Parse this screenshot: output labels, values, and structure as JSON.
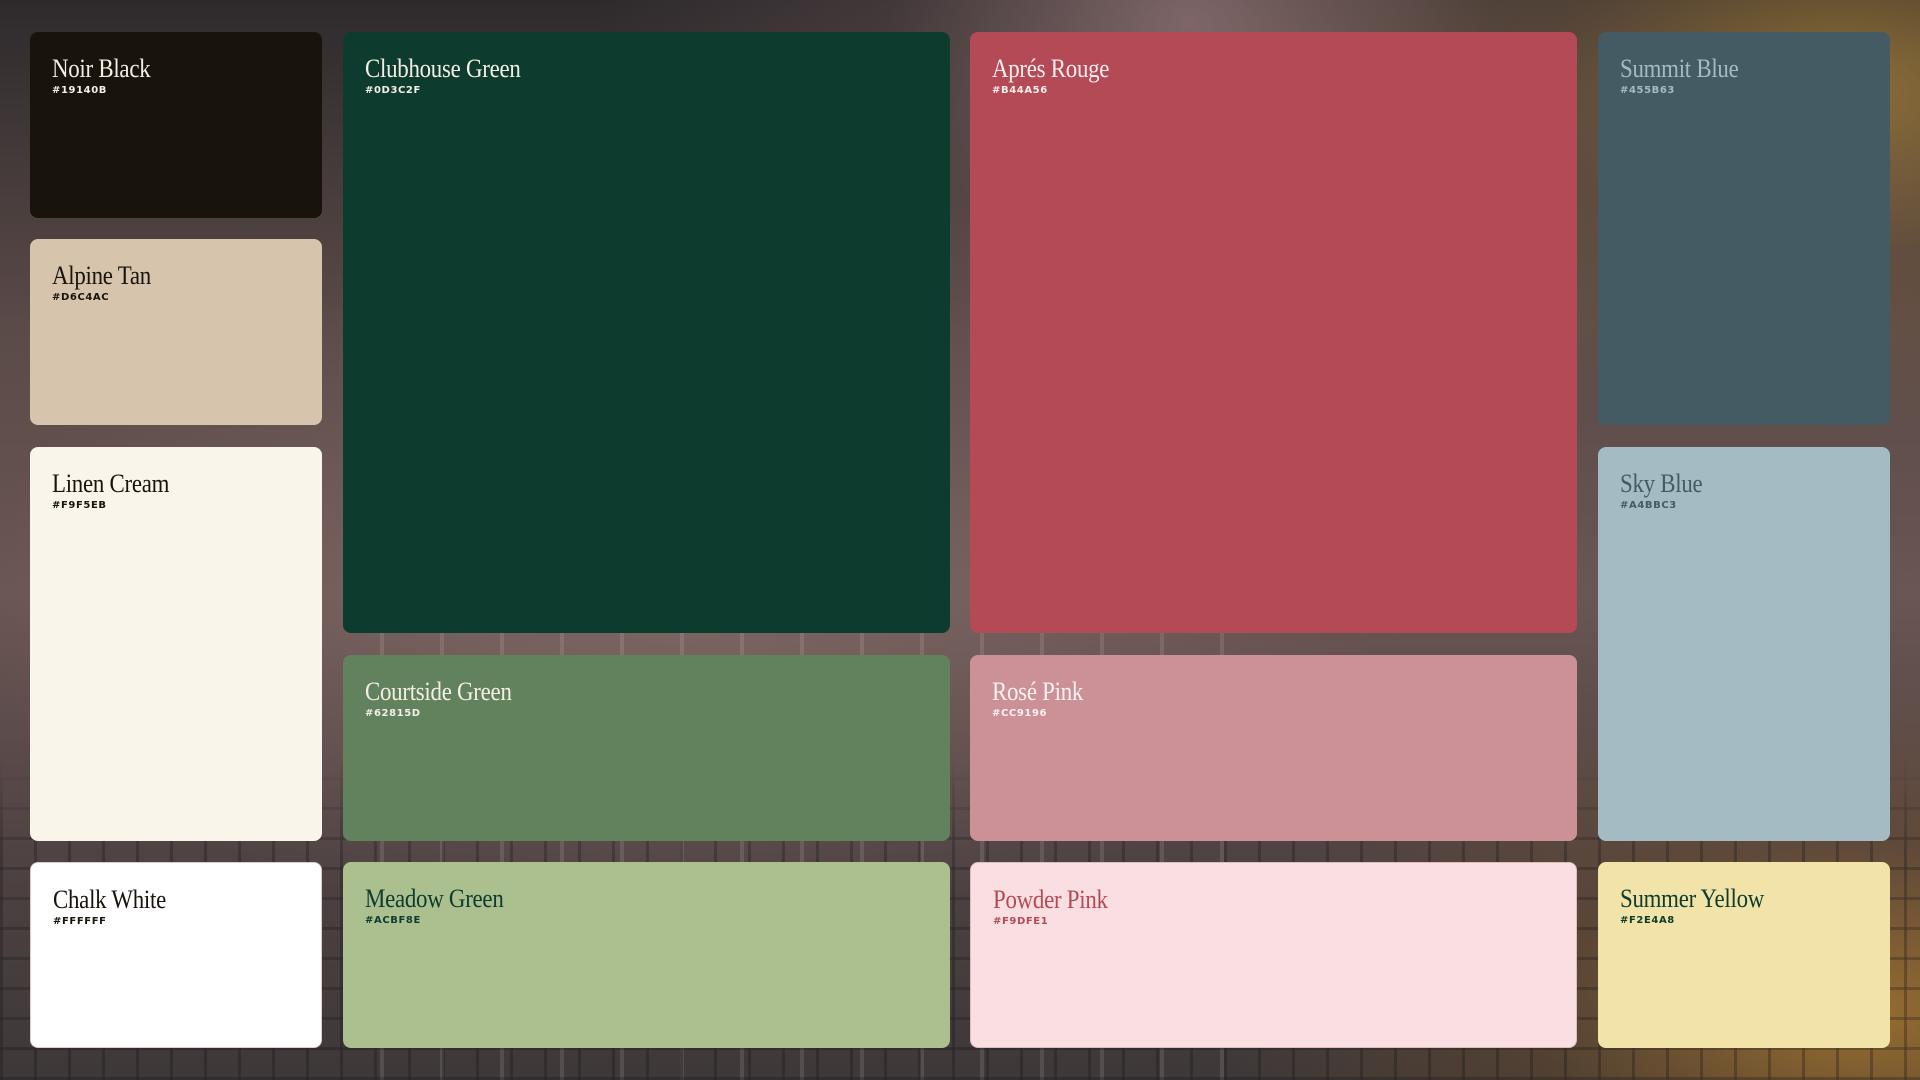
{
  "swatches": [
    {
      "id": "noir-black",
      "name": "Noir Black",
      "hex": "#19140B",
      "text_color": "#F4EFE6"
    },
    {
      "id": "alpine-tan",
      "name": "Alpine Tan",
      "hex": "#D6C4AC",
      "text_color": "#19140B"
    },
    {
      "id": "linen-cream",
      "name": "Linen Cream",
      "hex": "#F9F5EB",
      "text_color": "#19140B"
    },
    {
      "id": "chalk-white",
      "name": "Chalk White",
      "hex": "#FFFFFF",
      "text_color": "#19140B"
    },
    {
      "id": "clubhouse-green",
      "name": "Clubhouse Green",
      "hex": "#0D3C2F",
      "text_color": "#F4EFE6"
    },
    {
      "id": "courtside-green",
      "name": "Courtside Green",
      "hex": "#62815D",
      "text_color": "#F4EFE6"
    },
    {
      "id": "meadow-green",
      "name": "Meadow Green",
      "hex": "#ACBF8E",
      "text_color": "#0D3C2F"
    },
    {
      "id": "apres-rouge",
      "name": "Aprés Rouge",
      "hex": "#B44A56",
      "text_color": "#F9EDEE"
    },
    {
      "id": "rose-pink",
      "name": "Rosé Pink",
      "hex": "#CC9196",
      "text_color": "#FBF1F2"
    },
    {
      "id": "powder-pink",
      "name": "Powder Pink",
      "hex": "#F9DFE1",
      "text_color": "#B44A56"
    },
    {
      "id": "summit-blue",
      "name": "Summit Blue",
      "hex": "#455B63",
      "text_color": "#A4BBC3"
    },
    {
      "id": "sky-blue",
      "name": "Sky Blue",
      "hex": "#A4BBC3",
      "text_color": "#455B63"
    },
    {
      "id": "summer-yellow",
      "name": "Summer Yellow",
      "hex": "#F2E4A8",
      "text_color": "#0D3C2F"
    }
  ]
}
